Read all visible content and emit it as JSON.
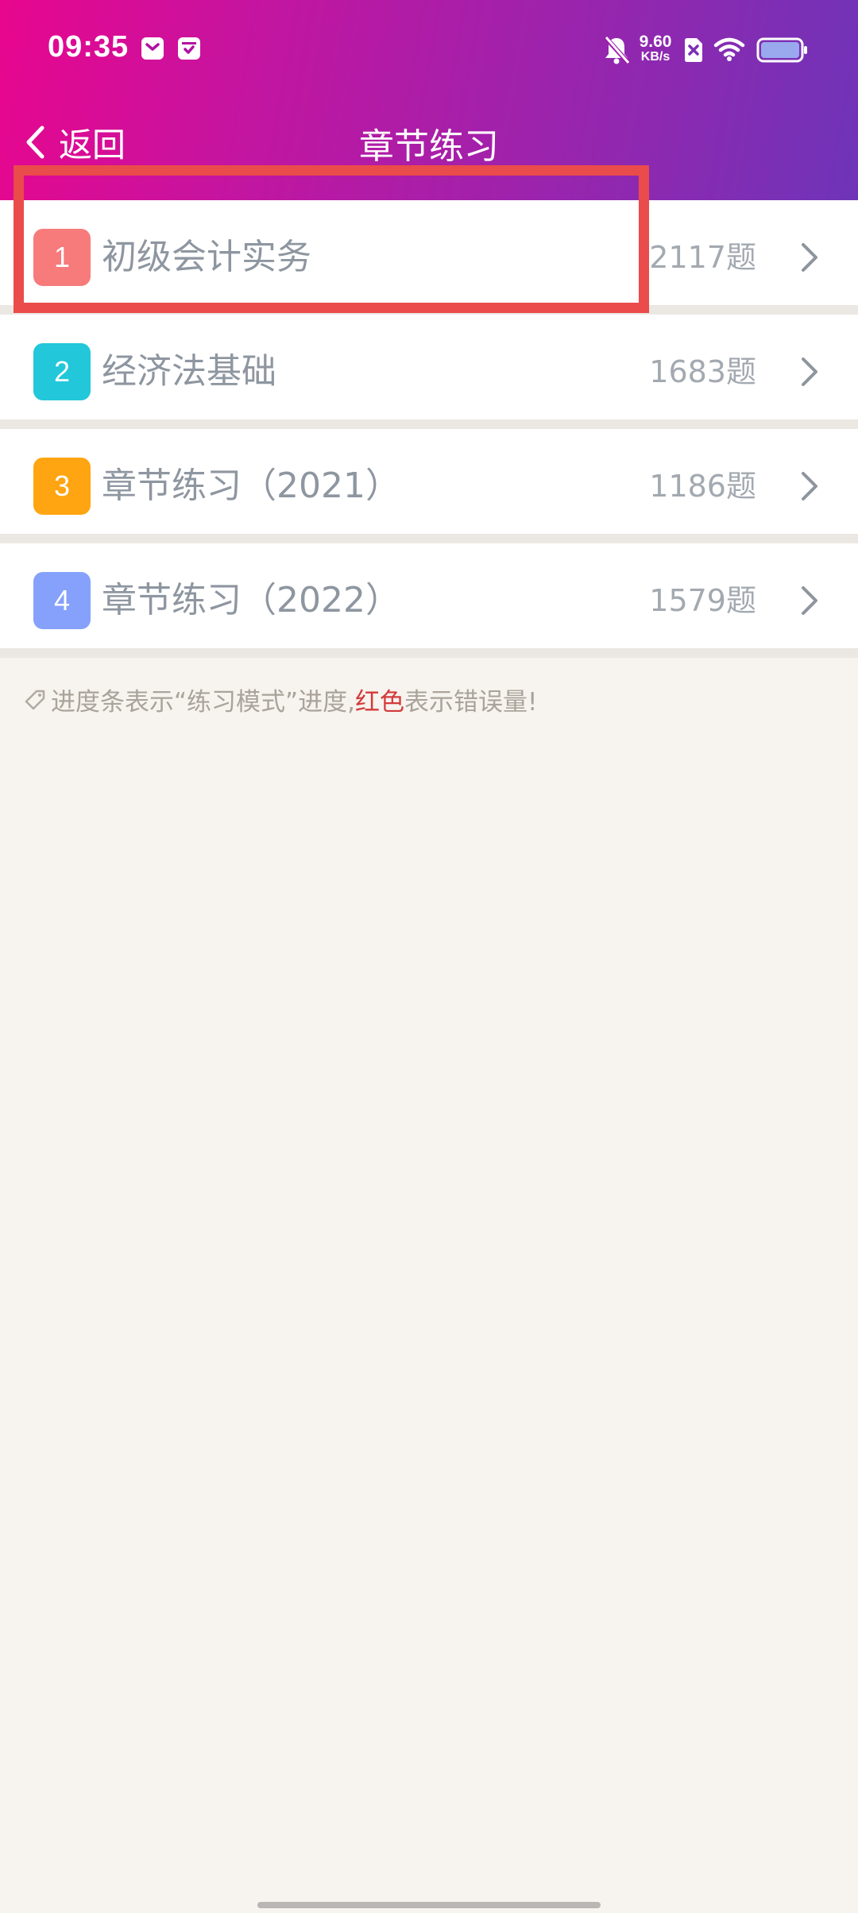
{
  "status_bar": {
    "time": "09:35",
    "net_speed_value": "9.60",
    "net_speed_unit": "KB/s"
  },
  "nav": {
    "back_label": "返回",
    "title": "章节练习"
  },
  "chapters": [
    {
      "index": "1",
      "name": "初级会计实务",
      "count": "2117题",
      "badge_color": "#f77b7b"
    },
    {
      "index": "2",
      "name": "经济法基础",
      "count": "1683题",
      "badge_color": "#22c7d9"
    },
    {
      "index": "3",
      "name": "章节练习（2021）",
      "count": "1186题",
      "badge_color": "#ffa512"
    },
    {
      "index": "4",
      "name": "章节练习（2022）",
      "count": "1579题",
      "badge_color": "#86a1fb"
    }
  ],
  "hint": {
    "prefix": "进度条表示“练习模式”进度,",
    "highlight": "红色",
    "suffix": "表示错误量!"
  },
  "colors": {
    "header_gradient_start": "#e8068e",
    "header_gradient_end": "#6e34b8",
    "highlight_red": "#d23b3b",
    "annotation_box": "#ea4b4b"
  }
}
